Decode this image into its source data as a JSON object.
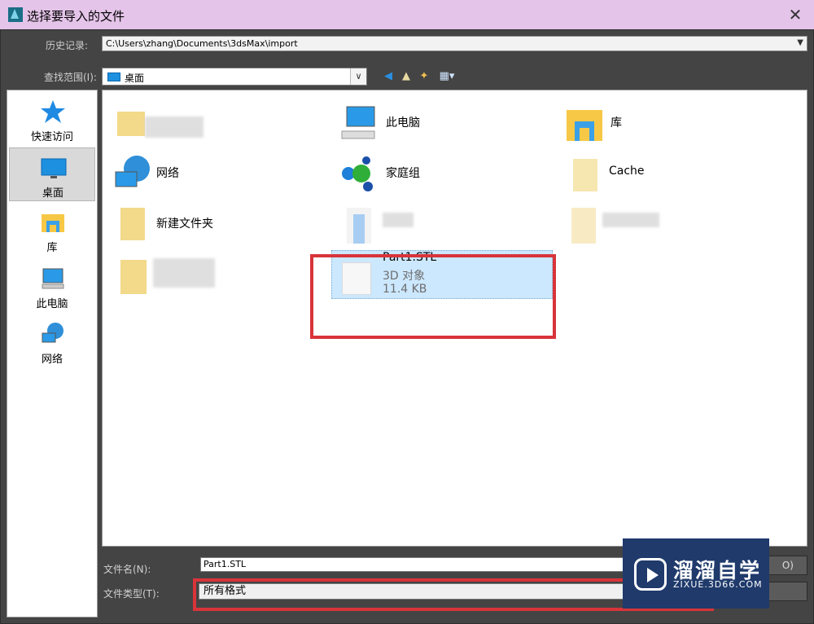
{
  "window": {
    "title": "选择要导入的文件",
    "close_symbol": "✕"
  },
  "history": {
    "label": "历史记录:",
    "value": "C:\\Users\\zhang\\Documents\\3dsMax\\import"
  },
  "lookin": {
    "label": "查找范围(I):",
    "value": "桌面"
  },
  "places": [
    {
      "label": "快速访问",
      "icon": "star-icon"
    },
    {
      "label": "桌面",
      "icon": "desktop-icon",
      "selected": true
    },
    {
      "label": "库",
      "icon": "library-icon"
    },
    {
      "label": "此电脑",
      "icon": "computer-icon"
    },
    {
      "label": "网络",
      "icon": "network-icon"
    }
  ],
  "items": {
    "this_pc": "此电脑",
    "library": "库",
    "network": "网络",
    "homegroup": "家庭组",
    "cache": "Cache",
    "new_folder": "新建文件夹"
  },
  "selected_file": {
    "name": "Part1.STL",
    "type": "3D 对象",
    "size": "11.4 KB"
  },
  "file_name": {
    "label": "文件名(N):",
    "value": "Part1.STL"
  },
  "file_type": {
    "label": "文件类型(T):",
    "value": "所有格式"
  },
  "buttons": {
    "open_suffix": "O)"
  },
  "watermark": {
    "brand": "溜溜自学",
    "url": "ZIXUE.3D66.COM"
  },
  "colors": {
    "titlebar": "#e5c4e9",
    "highlight": "#d8343a",
    "selection": "#cce8ff"
  }
}
